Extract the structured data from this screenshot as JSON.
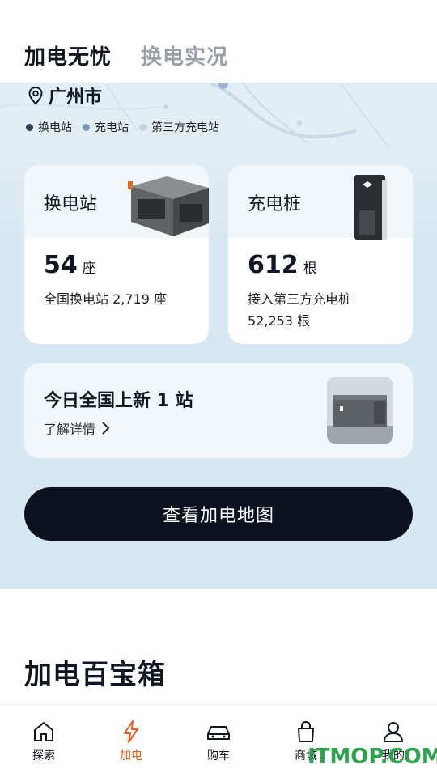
{
  "header": {
    "tabs": [
      {
        "label": "加电无忧",
        "active": true
      },
      {
        "label": "换电实况",
        "active": false
      }
    ]
  },
  "location": {
    "city": "广州市",
    "icon": "location-pin-icon"
  },
  "legend": [
    {
      "label": "换电站",
      "color": "#2d3d55"
    },
    {
      "label": "充电站",
      "color": "#7b9bbd"
    },
    {
      "label": "第三方充电站",
      "color": "#c2d3e2"
    }
  ],
  "swap_card": {
    "title": "换电站",
    "count": "54",
    "unit": "座",
    "national_line": "全国换电站 2,719 座"
  },
  "charger_card": {
    "title": "充电桩",
    "count": "612",
    "unit": "根",
    "third_party_line1": "接入第三方充电桩",
    "third_party_line2": "52,253 根"
  },
  "new_station": {
    "title": "今日全国上新 1 站",
    "link_label": "了解详情"
  },
  "map_button": {
    "label": "查看加电地图"
  },
  "toolbox": {
    "title": "加电百宝箱"
  },
  "bottom_nav": [
    {
      "label": "探索",
      "icon": "home-icon",
      "active": false
    },
    {
      "label": "加电",
      "icon": "lightning-icon",
      "active": true
    },
    {
      "label": "购车",
      "icon": "car-icon",
      "active": false
    },
    {
      "label": "商城",
      "icon": "shopping-bag-icon",
      "active": false
    },
    {
      "label": "我的",
      "icon": "person-icon",
      "active": false
    }
  ],
  "watermark": "ITMOP.COM",
  "colors": {
    "accent": "#e95a1b",
    "dark": "#0c1220",
    "map_bg": "#d7e8f3"
  }
}
